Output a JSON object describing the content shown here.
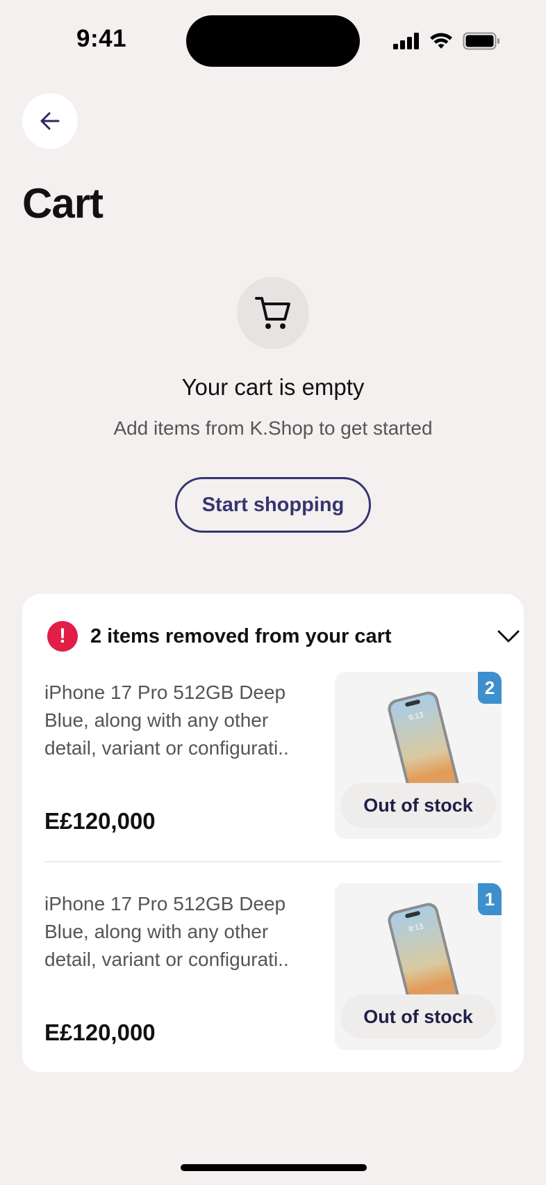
{
  "status_bar": {
    "time": "9:41"
  },
  "header": {
    "back_icon": "arrow-left-icon",
    "title": "Cart"
  },
  "empty_state": {
    "icon": "cart-icon",
    "title": "Your cart is empty",
    "subtitle": "Add items from K.Shop to get started",
    "button_label": "Start shopping"
  },
  "removed_section": {
    "alert_icon": "exclamation-icon",
    "alert_mark": "!",
    "title": "2 items removed from your cart",
    "toggle_icon": "chevron-down-icon",
    "items": [
      {
        "name": "iPhone 17 Pro 512GB Deep Blue, along with any other detail, variant or configurati..",
        "price": "E£120,000",
        "quantity": "2",
        "status": "Out of stock",
        "image": "phone-image"
      },
      {
        "name": "iPhone 17 Pro 512GB Deep Blue, along with any other detail, variant or configurati..",
        "price": "E£120,000",
        "quantity": "1",
        "status": "Out of stock",
        "image": "phone-image"
      }
    ]
  },
  "colors": {
    "background": "#f3f0ef",
    "accent": "#35356f",
    "alert": "#e11d48",
    "badge": "#3d8fce"
  }
}
